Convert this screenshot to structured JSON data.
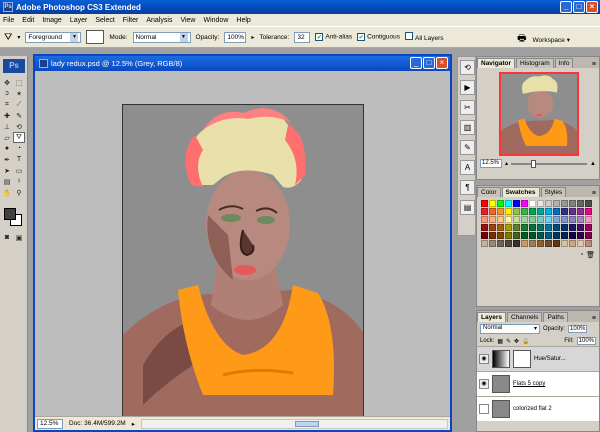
{
  "window": {
    "title": "Adobe Photoshop CS3 Extended",
    "min": "_",
    "max": "□",
    "close": "×",
    "ps_badge": "Ps"
  },
  "menu": [
    "File",
    "Edit",
    "Image",
    "Layer",
    "Select",
    "Filter",
    "Analysis",
    "View",
    "Window",
    "Help"
  ],
  "options": {
    "tool_preset": "Foreground",
    "mode_label": "Mode:",
    "mode_value": "Normal",
    "opacity_label": "Opacity:",
    "opacity_value": "100%",
    "tolerance_label": "Tolerance:",
    "tolerance_value": "32",
    "antialias_label": "Anti-alias",
    "contiguous_label": "Contiguous",
    "all_layers_label": "All Layers",
    "workspace_label": "Workspace"
  },
  "tools": {
    "logo": "Ps"
  },
  "document": {
    "title": "lady redux.psd @ 12.5% (Grey, RGB/8)",
    "zoom": "12.5%",
    "doc_info": "Doc: 36.4M/599.2M"
  },
  "navigator": {
    "tabs": [
      "Navigator",
      "Histogram",
      "Info"
    ],
    "zoom": "12.5%"
  },
  "color_panel": {
    "tabs": [
      "Color",
      "Swatches",
      "Styles"
    ]
  },
  "swatches": [
    "#ff0000",
    "#ffff00",
    "#00ff00",
    "#00ffff",
    "#0000ff",
    "#ff00ff",
    "#ffffff",
    "#e6e6e6",
    "#cccccc",
    "#b3b3b3",
    "#999999",
    "#808080",
    "#666666",
    "#4d4d4d",
    "#ed1c24",
    "#f26522",
    "#f7941d",
    "#fff200",
    "#8dc63f",
    "#39b54a",
    "#00a651",
    "#00a99d",
    "#00aeef",
    "#0072bc",
    "#2e3192",
    "#662d91",
    "#92278f",
    "#ec008c",
    "#f69679",
    "#f9ad81",
    "#fdc689",
    "#fff799",
    "#c4df9b",
    "#a3d39c",
    "#82ca9c",
    "#7accc8",
    "#6dcff6",
    "#7da7d9",
    "#8393ca",
    "#8781bd",
    "#a186be",
    "#f49ac1",
    "#9e0b0f",
    "#a0410d",
    "#a3620a",
    "#aba000",
    "#598527",
    "#197b30",
    "#007236",
    "#00746b",
    "#0076a3",
    "#004a80",
    "#003471",
    "#1b1464",
    "#440e62",
    "#9e005d",
    "#790000",
    "#7b2e00",
    "#7d4900",
    "#827b00",
    "#406618",
    "#005e20",
    "#005826",
    "#005952",
    "#005b7f",
    "#003663",
    "#002157",
    "#0d004c",
    "#32004b",
    "#7b0046",
    "#c7b299",
    "#998675",
    "#736357",
    "#534741",
    "#37302d",
    "#c69c6d",
    "#a67c52",
    "#8c6239",
    "#754c24",
    "#603913",
    "#d9c39b",
    "#c8a882",
    "#e8c6a8",
    "#b88f78"
  ],
  "layers": {
    "tabs": [
      "Layers",
      "Channels",
      "Paths"
    ],
    "blend": "Normal",
    "opacity_label": "Opacity:",
    "opacity_value": "100%",
    "lock_label": "Lock:",
    "fill_label": "Fill:",
    "fill_value": "100%",
    "rows": [
      {
        "name": "Hue/Satur...",
        "visible": true
      },
      {
        "name": "Flats 5 copy",
        "visible": true
      },
      {
        "name": "colorized flat 2",
        "visible": false
      }
    ]
  },
  "colors": {
    "accent": "#0a46c2",
    "hair_tip": "#ff6f6f",
    "hair_base": "#e8e0a8",
    "skin": "#b08076",
    "top": "#ff9a18",
    "bg": "#8e8e8e"
  }
}
